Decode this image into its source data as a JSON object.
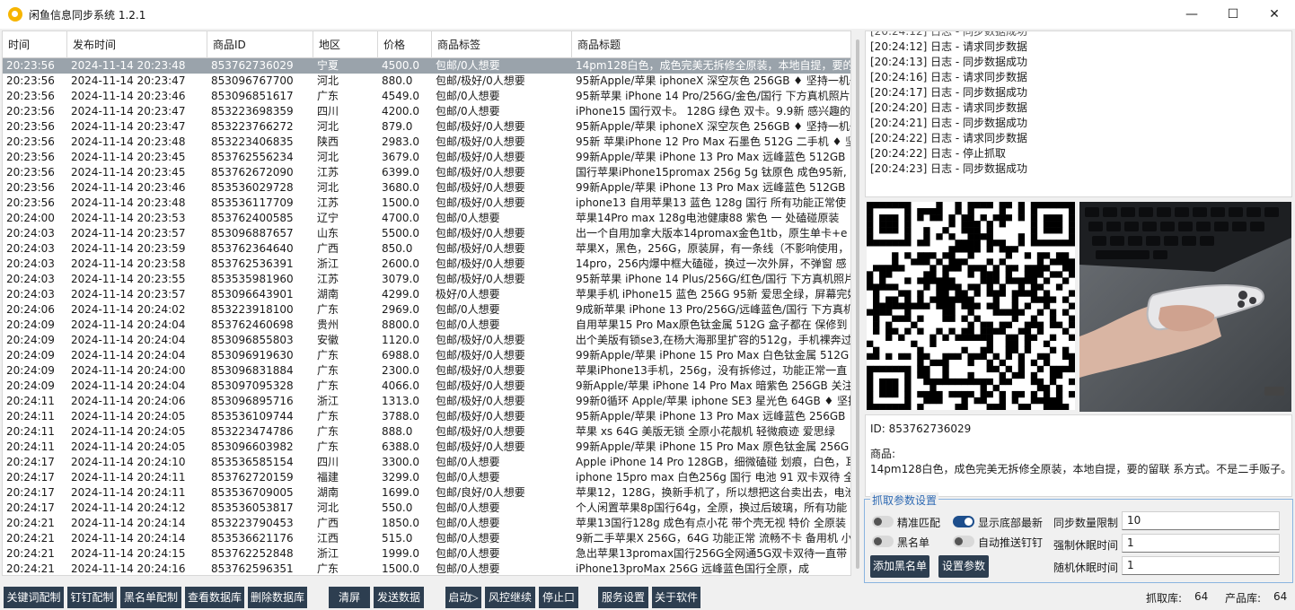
{
  "window": {
    "title": "闲鱼信息同步系统 1.2.1",
    "minimize": "—",
    "maximize": "☐",
    "close": "✕"
  },
  "table": {
    "headers": [
      "时间",
      "发布时间",
      "商品ID",
      "地区",
      "价格",
      "商品标签",
      "商品标题"
    ],
    "rows": [
      [
        "20:23:56",
        "2024-11-14 20:23:48",
        "853762736029",
        "宁夏",
        "4500.0",
        "包邮/0人想要",
        "14pm128白色，成色完美无拆修全原装，本地自提，要的"
      ],
      [
        "20:23:56",
        "2024-11-14 20:23:47",
        "853096767700",
        "河北",
        "880.0",
        "包邮/极好/0人想要",
        "95新Apple/苹果 iphoneX 深空灰色 256GB ♦ 坚持一机一"
      ],
      [
        "20:23:56",
        "2024-11-14 20:23:46",
        "853096851617",
        "广东",
        "4549.0",
        "包邮/0人想要",
        "95新苹果 iPhone 14 Pro/256G/金色/国行 下方真机照片"
      ],
      [
        "20:23:56",
        "2024-11-14 20:23:47",
        "853223698359",
        "四川",
        "4200.0",
        "包邮/0人想要",
        "iPhone15 国行双卡。 128G 绿色 双卡。9.9新 感兴趣的"
      ],
      [
        "20:23:56",
        "2024-11-14 20:23:47",
        "853223766272",
        "河北",
        "879.0",
        "包邮/极好/0人想要",
        "95新Apple/苹果 iphoneX 深空灰色 256GB ♦ 坚持一机一"
      ],
      [
        "20:23:56",
        "2024-11-14 20:23:48",
        "853223406835",
        "陕西",
        "2983.0",
        "包邮/极好/0人想要",
        "95新 苹果iPhone 12 Pro Max 石墨色 512G 二手机 ♦ 坚"
      ],
      [
        "20:23:56",
        "2024-11-14 20:23:45",
        "853762556234",
        "河北",
        "3679.0",
        "包邮/极好/0人想要",
        "99新Apple/苹果 iPhone 13 Pro Max 远峰蓝色 512GB"
      ],
      [
        "20:23:56",
        "2024-11-14 20:23:45",
        "853762672090",
        "江苏",
        "6399.0",
        "包邮/极好/0人想要",
        "国行苹果iPhone15promax 256g 5g 钛原色 成色95新,"
      ],
      [
        "20:23:56",
        "2024-11-14 20:23:46",
        "853536029728",
        "河北",
        "3680.0",
        "包邮/极好/0人想要",
        "99新Apple/苹果 iPhone 13 Pro Max 远峰蓝色 512GB"
      ],
      [
        "20:23:56",
        "2024-11-14 20:23:48",
        "853536117709",
        "江苏",
        "1500.0",
        "包邮/极好/0人想要",
        "iphone13 自用苹果13 蓝色  128g 国行 所有功能正常使"
      ],
      [
        "20:24:00",
        "2024-11-14 20:23:53",
        "853762400585",
        "辽宁",
        "4700.0",
        "包邮/0人想要",
        "苹果14Pro max 128g电池健康88  紫色  一 处磕碰原装"
      ],
      [
        "20:24:03",
        "2024-11-14 20:23:57",
        "853096887657",
        "山东",
        "5500.0",
        "包邮/极好/0人想要",
        "出一个自用加拿大版本14promax金色1tb，原生单卡+e"
      ],
      [
        "20:24:03",
        "2024-11-14 20:23:59",
        "853762364640",
        "广西",
        "850.0",
        "包邮/极好/0人想要",
        "苹果X，黑色，256G，原装屏，有一条线（不影响使用，"
      ],
      [
        "20:24:03",
        "2024-11-14 20:23:58",
        "853762536391",
        "浙江",
        "2600.0",
        "包邮/极好/0人想要",
        "14pro，256内爆中框大磕碰，换过一次外屏，不弹窗 感"
      ],
      [
        "20:24:03",
        "2024-11-14 20:23:55",
        "853535981960",
        "江苏",
        "3079.0",
        "包邮/极好/0人想要",
        "95新苹果 iPhone 14 Plus/256G/红色/国行 下方真机照片"
      ],
      [
        "20:24:03",
        "2024-11-14 20:23:57",
        "853096643901",
        "湖南",
        "4299.0",
        "极好/0人想要",
        "苹果手机 iPhone15 蓝色 256G 95新 爱思全绿，屏幕完好"
      ],
      [
        "20:24:06",
        "2024-11-14 20:24:02",
        "853223918100",
        "广东",
        "2969.0",
        "包邮/0人想要",
        "9成新苹果 iPhone 13 Pro/256G/远峰蓝色/国行 下方真机"
      ],
      [
        "20:24:09",
        "2024-11-14 20:24:04",
        "853762460698",
        "贵州",
        "8800.0",
        "包邮/0人想要",
        "自用苹果15 Pro Max原色钛金属 512G 盒子都在 保修到"
      ],
      [
        "20:24:09",
        "2024-11-14 20:24:04",
        "853096855803",
        "安徽",
        "1120.0",
        "包邮/极好/0人想要",
        "出个美版有锁se3,在杨大海那里扩容的512g，手机裸奔过"
      ],
      [
        "20:24:09",
        "2024-11-14 20:24:04",
        "853096919630",
        "广东",
        "6988.0",
        "包邮/极好/0人想要",
        "99新Apple/苹果 iPhone 15 Pro Max 白色钛金属 512G"
      ],
      [
        "20:24:09",
        "2024-11-14 20:24:00",
        "853096831884",
        "广东",
        "2300.0",
        "包邮/极好/0人想要",
        "苹果iPhone13手机，256g，没有拆修过，功能正常一直"
      ],
      [
        "20:24:09",
        "2024-11-14 20:24:04",
        "853097095328",
        "广东",
        "4066.0",
        "包邮/极好/0人想要",
        "9新Apple/苹果 iPhone 14 Pro Max 暗紫色 256GB 关注"
      ],
      [
        "20:24:11",
        "2024-11-14 20:24:06",
        "853096895716",
        "浙江",
        "1313.0",
        "包邮/极好/0人想要",
        "99新0循环 Apple/苹果 iphone SE3 星光色 64GB ♦ 坚持"
      ],
      [
        "20:24:11",
        "2024-11-14 20:24:05",
        "853536109744",
        "广东",
        "3788.0",
        "包邮/极好/0人想要",
        "95新Apple/苹果 iPhone 13 Pro Max 远峰蓝色 256GB"
      ],
      [
        "20:24:11",
        "2024-11-14 20:24:05",
        "853223474786",
        "广东",
        "888.0",
        "包邮/极好/0人想要",
        "苹果 xs  64G  美版无锁 全原小花靓机 轻微痕迹 爱思绿"
      ],
      [
        "20:24:11",
        "2024-11-14 20:24:05",
        "853096603982",
        "广东",
        "6388.0",
        "包邮/极好/0人想要",
        "99新Apple/苹果 iPhone 15 Pro Max 原色钛金属 256G"
      ],
      [
        "20:24:17",
        "2024-11-14 20:24:10",
        "853536585154",
        "四川",
        "3300.0",
        "包邮/0人想要",
        "Apple iPhone 14 Pro 128GB，细微磕碰 划痕，白色，耳"
      ],
      [
        "20:24:17",
        "2024-11-14 20:24:11",
        "853762720159",
        "福建",
        "3299.0",
        "包邮/0人想要",
        "iphone 15pro max 白色256g 国行 电池 91 双卡双待 全"
      ],
      [
        "20:24:17",
        "2024-11-14 20:24:11",
        "853536709005",
        "湖南",
        "1699.0",
        "包邮/良好/0人想要",
        "苹果12，128G，换新手机了，所以想把这台卖出去，电池"
      ],
      [
        "20:24:17",
        "2024-11-14 20:24:12",
        "853536053817",
        "河北",
        "550.0",
        "包邮/0人想要",
        "个人闲置苹果8p国行64g，全原，换过后玻璃，所有功能"
      ],
      [
        "20:24:21",
        "2024-11-14 20:24:14",
        "853223790453",
        "广西",
        "1850.0",
        "包邮/0人想要",
        "苹果13国行128g 成色有点小花 带个壳无视 特价 全原装"
      ],
      [
        "20:24:21",
        "2024-11-14 20:24:14",
        "853536621176",
        "江西",
        "515.0",
        "包邮/0人想要",
        "9新二手苹果X 256G，64G 功能正常 流畅不卡 备用机 小"
      ],
      [
        "20:24:21",
        "2024-11-14 20:24:15",
        "853762252848",
        "浙江",
        "1999.0",
        "包邮/0人想要",
        "急出苹果13promax国行256G全网通5G双卡双待一直带"
      ],
      [
        "20:24:21",
        "2024-11-14 20:24:16",
        "853762596351",
        "广东",
        "1500.0",
        "包邮/0人想要",
        "iPhone13proMax 256G 远峰蓝色国行全原，成"
      ]
    ]
  },
  "log": {
    "lines": [
      "[20:24:12] 日志 - 同步数据成功",
      "[20:24:12] 日志 - 请求同步数据",
      "[20:24:13] 日志 - 同步数据成功",
      "[20:24:16] 日志 - 请求同步数据",
      "[20:24:17] 日志 - 同步数据成功",
      "[20:24:20] 日志 - 请求同步数据",
      "[20:24:21] 日志 - 同步数据成功",
      "[20:24:22] 日志 - 请求同步数据",
      "[20:24:22] 日志 - 停止抓取",
      "[20:24:23] 日志 - 同步数据成功"
    ]
  },
  "detail": {
    "id_line": "ID: 853762736029",
    "product_label": "商品:",
    "product_text": "14pm128白色，成色完美无拆修全原装，本地自提，要的留联 系方式。不是二手贩子。"
  },
  "params": {
    "legend": "抓取参数设置",
    "exact_match": "精准匹配",
    "show_latest": "显示底部最新",
    "blacklist": "黑名单",
    "auto_push": "自动推送钉钉",
    "sync_limit_label": "同步数量限制",
    "sync_limit_value": "10",
    "force_sleep_label": "强制休眠时间",
    "force_sleep_value": "1",
    "random_sleep_label": "随机休眠时间",
    "random_sleep_value": "1",
    "add_blacklist_btn": "添加黑名单",
    "set_params_btn": "设置参数",
    "toggles": {
      "exact_match": false,
      "show_latest": true,
      "blacklist": false,
      "auto_push": false
    }
  },
  "toolbar": {
    "keyword_config": "关键词配制",
    "dingtalk_config": "钉钉配制",
    "blacklist_config": "黑名单配制",
    "view_db": "查看数据库",
    "delete_db": "删除数据库",
    "clear_screen": "清屏",
    "send_data": "发送数据",
    "start": "启动▷",
    "risk_continue": "风控继续",
    "stop": "停止口",
    "service_settings": "服务设置",
    "about": "关于软件",
    "fetch_db_label": "抓取库:",
    "fetch_db_count": "64",
    "product_db_label": "产品库:",
    "product_db_count": "64"
  },
  "colors": {
    "button_bg": "#2d3e50",
    "selected_row": "#9aa3ab",
    "group_border": "#8ab4e0",
    "toggle_on": "#1d4e8c",
    "app_icon": "#f7b500"
  }
}
